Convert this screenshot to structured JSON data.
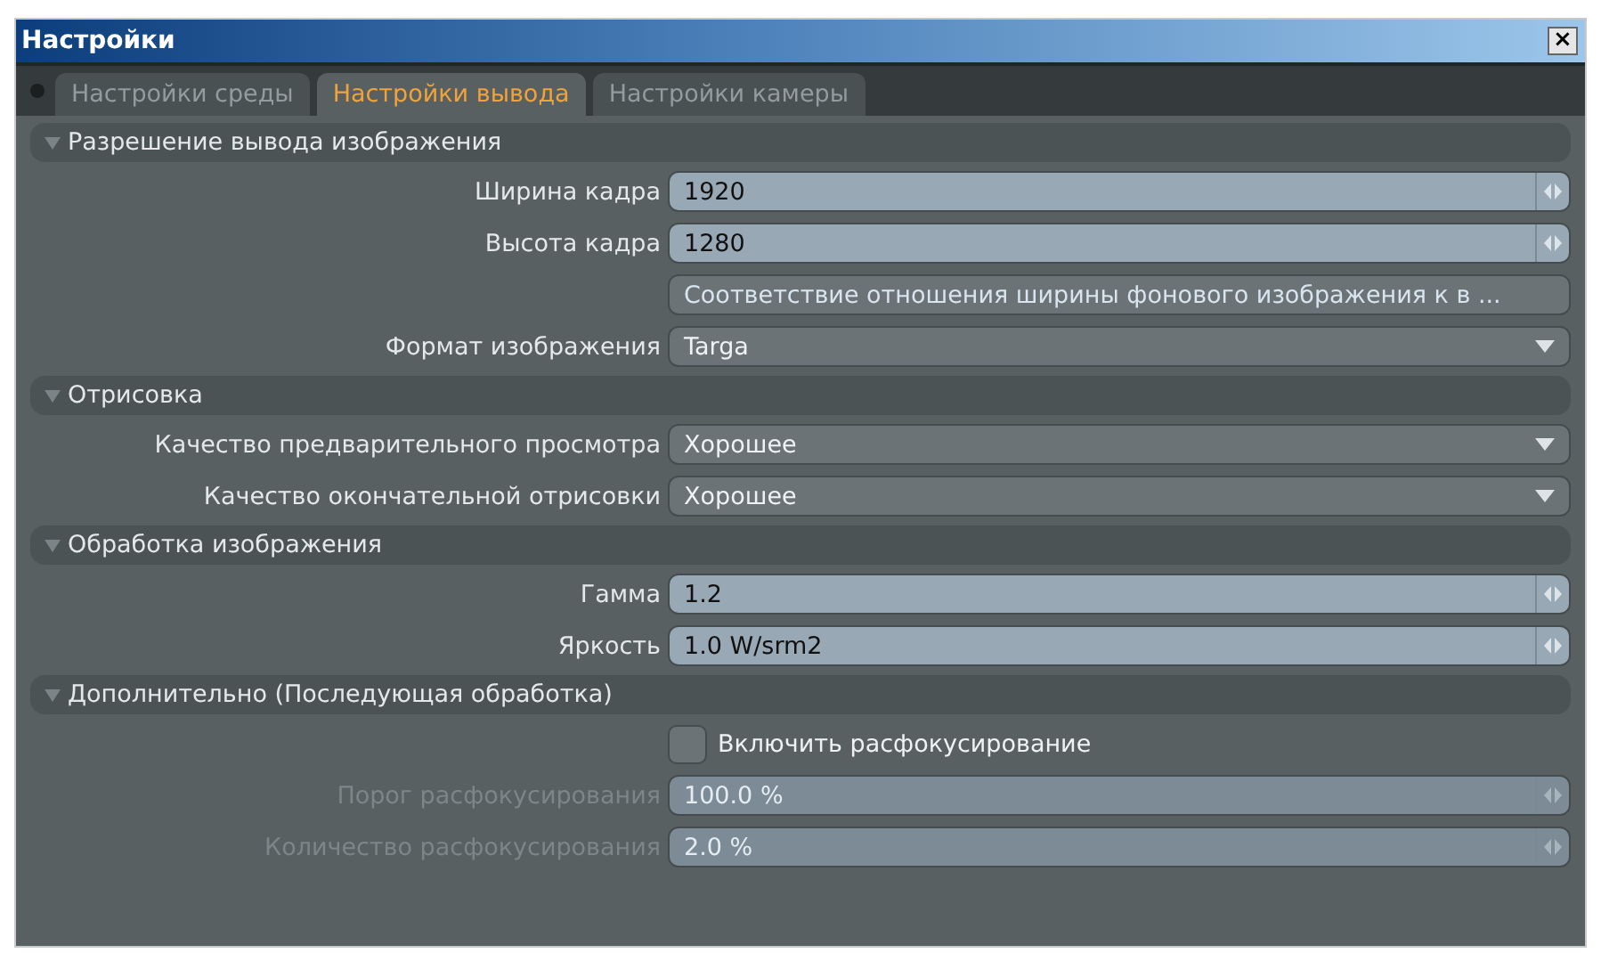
{
  "window": {
    "title": "Настройки",
    "close": "×"
  },
  "tabs": [
    {
      "label": "Настройки среды",
      "selected": false
    },
    {
      "label": "Настройки вывода",
      "selected": true
    },
    {
      "label": "Настройки камеры",
      "selected": false
    }
  ],
  "sections": [
    {
      "title": "Разрешение вывода изображения",
      "expanded": true,
      "rows": [
        {
          "kind": "number",
          "label": "Ширина кадра",
          "value": "1920",
          "disabled": false
        },
        {
          "kind": "number",
          "label": "Высота кадра",
          "value": "1280",
          "disabled": false
        },
        {
          "kind": "button",
          "value": "Соответствие отношения ширины фонового изображения к в  ..."
        },
        {
          "kind": "dropdown",
          "label": "Формат изображения",
          "value": "Targa"
        }
      ]
    },
    {
      "title": "Отрисовка",
      "expanded": true,
      "rows": [
        {
          "kind": "dropdown",
          "label": "Качество предварительного просмотра",
          "value": "Хорошее"
        },
        {
          "kind": "dropdown",
          "label": "Качество окончательной отрисовки",
          "value": "Хорошее"
        }
      ]
    },
    {
      "title": "Обработка изображения",
      "expanded": true,
      "rows": [
        {
          "kind": "number",
          "label": "Гамма",
          "value": "1.2",
          "disabled": false
        },
        {
          "kind": "number",
          "label": "Яркость",
          "value": "1.0 W/srm2",
          "disabled": false
        }
      ]
    },
    {
      "title": "Дополнительно (Последующая обработка)",
      "expanded": true,
      "rows": [
        {
          "kind": "checkbox",
          "label": "Включить расфокусирование",
          "checked": false
        },
        {
          "kind": "number",
          "label": "Порог расфокусирования",
          "value": "100.0 %",
          "disabled": true
        },
        {
          "kind": "number",
          "label": "Количество расфокусирования",
          "value": "2.0 %",
          "disabled": true
        }
      ]
    }
  ]
}
